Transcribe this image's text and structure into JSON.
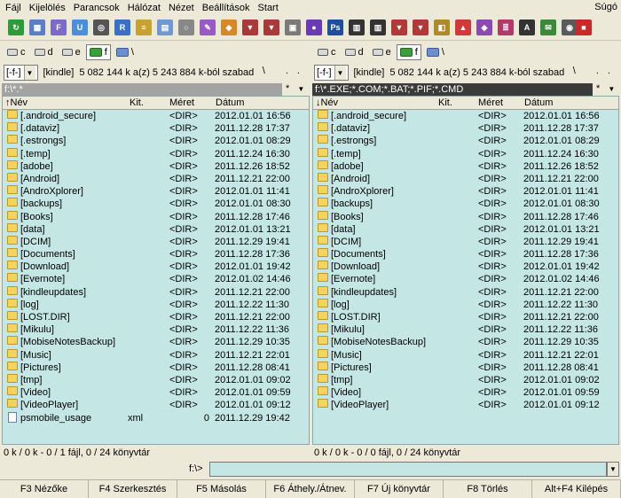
{
  "menu": {
    "items": [
      "Fájl",
      "Kijelölés",
      "Parancsok",
      "Hálózat",
      "Nézet",
      "Beállítások",
      "Start"
    ],
    "help": "Súgó"
  },
  "toolbar_icons": [
    {
      "name": "refresh-icon",
      "color": "#2f9a3a",
      "glyph": "↻"
    },
    {
      "name": "thumbnails-icon",
      "color": "#5a7fc8",
      "glyph": "▦"
    },
    {
      "name": "ftp-icon",
      "color": "#7c6bc4",
      "glyph": "F"
    },
    {
      "name": "url-icon",
      "color": "#4c8fd6",
      "glyph": "U"
    },
    {
      "name": "binoculars-icon",
      "color": "#555555",
      "glyph": "◎"
    },
    {
      "name": "multi-rename-icon",
      "color": "#3a6fc4",
      "glyph": "R"
    },
    {
      "name": "compare-icon",
      "color": "#c8a037",
      "glyph": "≡"
    },
    {
      "name": "calculator-icon",
      "color": "#6f9ad0",
      "glyph": "▤"
    },
    {
      "name": "comment-icon",
      "color": "#888888",
      "glyph": "○"
    },
    {
      "name": "edit-icon",
      "color": "#9a5ac4",
      "glyph": "✎"
    },
    {
      "name": "sync-icon",
      "color": "#d48a2a",
      "glyph": "◆"
    },
    {
      "name": "pack-icon",
      "color": "#a83a3a",
      "glyph": "▼"
    },
    {
      "name": "unpack-icon",
      "color": "#a83a3a",
      "glyph": "▼"
    },
    {
      "name": "app-icon",
      "color": "#7a7a7a",
      "glyph": "▣"
    },
    {
      "name": "media-icon",
      "color": "#6a3ab0",
      "glyph": "●"
    },
    {
      "name": "photoshop-icon",
      "color": "#1f4f9a",
      "glyph": "Ps"
    },
    {
      "name": "film-icon",
      "color": "#333333",
      "glyph": "▥"
    },
    {
      "name": "film2-icon",
      "color": "#333333",
      "glyph": "▥"
    },
    {
      "name": "archive-icon",
      "color": "#b03a3a",
      "glyph": "▼"
    },
    {
      "name": "archive2-icon",
      "color": "#b03a3a",
      "glyph": "▼"
    },
    {
      "name": "image-icon",
      "color": "#b08a2a",
      "glyph": "◧"
    },
    {
      "name": "chart-icon",
      "color": "#d03a3a",
      "glyph": "▲"
    },
    {
      "name": "tag-icon",
      "color": "#8a4ab0",
      "glyph": "◆"
    },
    {
      "name": "books-icon",
      "color": "#b03a6a",
      "glyph": "≣"
    },
    {
      "name": "font-icon",
      "color": "#333333",
      "glyph": "A"
    },
    {
      "name": "mail-icon",
      "color": "#3a8a3a",
      "glyph": "✉"
    },
    {
      "name": "cd-icon",
      "color": "#5a5a5a",
      "glyph": "◉"
    },
    {
      "name": "stop-icon",
      "color": "#c82a2a",
      "glyph": "■"
    }
  ],
  "left": {
    "drives": [
      "c",
      "d",
      "e",
      "f",
      "\\"
    ],
    "active_drive": "f",
    "drive_select": "[-f-]",
    "volume": "[kindle]",
    "free_text": "5 082 144 k a(z) 5 243 884 k-ból szabad",
    "nav_root": "\\",
    "nav_up": "..",
    "path": "f:\\*.*",
    "path_star": "*",
    "path_arrow": "▼",
    "headers": {
      "name": "↑Név",
      "ext": "Kit.",
      "size": "Méret",
      "date": "Dátum"
    },
    "rows": [
      {
        "name": "[.android_secure]",
        "ext": "",
        "size": "<DIR>",
        "date": "2012.01.01 16:56",
        "type": "dir"
      },
      {
        "name": "[.dataviz]",
        "ext": "",
        "size": "<DIR>",
        "date": "2011.12.28 17:37",
        "type": "dir"
      },
      {
        "name": "[.estrongs]",
        "ext": "",
        "size": "<DIR>",
        "date": "2012.01.01 08:29",
        "type": "dir"
      },
      {
        "name": "[.temp]",
        "ext": "",
        "size": "<DIR>",
        "date": "2011.12.24 16:30",
        "type": "dir"
      },
      {
        "name": "[adobe]",
        "ext": "",
        "size": "<DIR>",
        "date": "2011.12.26 18:52",
        "type": "dir"
      },
      {
        "name": "[Android]",
        "ext": "",
        "size": "<DIR>",
        "date": "2011.12.21 22:00",
        "type": "dir"
      },
      {
        "name": "[AndroXplorer]",
        "ext": "",
        "size": "<DIR>",
        "date": "2012.01.01 11:41",
        "type": "dir"
      },
      {
        "name": "[backups]",
        "ext": "",
        "size": "<DIR>",
        "date": "2012.01.01 08:30",
        "type": "dir"
      },
      {
        "name": "[Books]",
        "ext": "",
        "size": "<DIR>",
        "date": "2011.12.28 17:46",
        "type": "dir"
      },
      {
        "name": "[data]",
        "ext": "",
        "size": "<DIR>",
        "date": "2012.01.01 13:21",
        "type": "dir"
      },
      {
        "name": "[DCIM]",
        "ext": "",
        "size": "<DIR>",
        "date": "2011.12.29 19:41",
        "type": "dir"
      },
      {
        "name": "[Documents]",
        "ext": "",
        "size": "<DIR>",
        "date": "2011.12.28 17:36",
        "type": "dir"
      },
      {
        "name": "[Download]",
        "ext": "",
        "size": "<DIR>",
        "date": "2012.01.01 19:42",
        "type": "dir"
      },
      {
        "name": "[Evernote]",
        "ext": "",
        "size": "<DIR>",
        "date": "2012.01.02 14:46",
        "type": "dir"
      },
      {
        "name": "[kindleupdates]",
        "ext": "",
        "size": "<DIR>",
        "date": "2011.12.21 22:00",
        "type": "dir"
      },
      {
        "name": "[log]",
        "ext": "",
        "size": "<DIR>",
        "date": "2011.12.22 11:30",
        "type": "dir"
      },
      {
        "name": "[LOST.DIR]",
        "ext": "",
        "size": "<DIR>",
        "date": "2011.12.21 22:00",
        "type": "dir"
      },
      {
        "name": "[Mikulu]",
        "ext": "",
        "size": "<DIR>",
        "date": "2011.12.22 11:36",
        "type": "dir"
      },
      {
        "name": "[MobiseNotesBackup]",
        "ext": "",
        "size": "<DIR>",
        "date": "2011.12.29 10:35",
        "type": "dir"
      },
      {
        "name": "[Music]",
        "ext": "",
        "size": "<DIR>",
        "date": "2011.12.21 22:01",
        "type": "dir"
      },
      {
        "name": "[Pictures]",
        "ext": "",
        "size": "<DIR>",
        "date": "2011.12.28 08:41",
        "type": "dir"
      },
      {
        "name": "[tmp]",
        "ext": "",
        "size": "<DIR>",
        "date": "2012.01.01 09:02",
        "type": "dir"
      },
      {
        "name": "[Video]",
        "ext": "",
        "size": "<DIR>",
        "date": "2012.01.01 09:59",
        "type": "dir"
      },
      {
        "name": "[VideoPlayer]",
        "ext": "",
        "size": "<DIR>",
        "date": "2012.01.01 09:12",
        "type": "dir"
      },
      {
        "name": "psmobile_usage",
        "ext": "xml",
        "size": "0",
        "date": "2011.12.29 19:42",
        "type": "file"
      }
    ],
    "status": "0 k / 0 k - 0 / 1 fájl, 0 / 24 könyvtár"
  },
  "right": {
    "drives": [
      "c",
      "d",
      "e",
      "f",
      "\\"
    ],
    "active_drive": "f",
    "drive_select": "[-f-]",
    "volume": "[kindle]",
    "free_text": "5 082 144 k a(z) 5 243 884 k-ból szabad",
    "nav_root": "\\",
    "nav_up": "..",
    "path": "f:\\*.EXE;*.COM;*.BAT;*.PIF;*.CMD",
    "path_star": "*",
    "path_arrow": "▼",
    "headers": {
      "name": "↓Név",
      "ext": "Kit.",
      "size": "Méret",
      "date": "Dátum"
    },
    "rows": [
      {
        "name": "[.android_secure]",
        "ext": "",
        "size": "<DIR>",
        "date": "2012.01.01 16:56",
        "type": "dir"
      },
      {
        "name": "[.dataviz]",
        "ext": "",
        "size": "<DIR>",
        "date": "2011.12.28 17:37",
        "type": "dir"
      },
      {
        "name": "[.estrongs]",
        "ext": "",
        "size": "<DIR>",
        "date": "2012.01.01 08:29",
        "type": "dir"
      },
      {
        "name": "[.temp]",
        "ext": "",
        "size": "<DIR>",
        "date": "2011.12.24 16:30",
        "type": "dir"
      },
      {
        "name": "[adobe]",
        "ext": "",
        "size": "<DIR>",
        "date": "2011.12.26 18:52",
        "type": "dir"
      },
      {
        "name": "[Android]",
        "ext": "",
        "size": "<DIR>",
        "date": "2011.12.21 22:00",
        "type": "dir"
      },
      {
        "name": "[AndroXplorer]",
        "ext": "",
        "size": "<DIR>",
        "date": "2012.01.01 11:41",
        "type": "dir"
      },
      {
        "name": "[backups]",
        "ext": "",
        "size": "<DIR>",
        "date": "2012.01.01 08:30",
        "type": "dir"
      },
      {
        "name": "[Books]",
        "ext": "",
        "size": "<DIR>",
        "date": "2011.12.28 17:46",
        "type": "dir"
      },
      {
        "name": "[data]",
        "ext": "",
        "size": "<DIR>",
        "date": "2012.01.01 13:21",
        "type": "dir"
      },
      {
        "name": "[DCIM]",
        "ext": "",
        "size": "<DIR>",
        "date": "2011.12.29 19:41",
        "type": "dir"
      },
      {
        "name": "[Documents]",
        "ext": "",
        "size": "<DIR>",
        "date": "2011.12.28 17:36",
        "type": "dir"
      },
      {
        "name": "[Download]",
        "ext": "",
        "size": "<DIR>",
        "date": "2012.01.01 19:42",
        "type": "dir"
      },
      {
        "name": "[Evernote]",
        "ext": "",
        "size": "<DIR>",
        "date": "2012.01.02 14:46",
        "type": "dir"
      },
      {
        "name": "[kindleupdates]",
        "ext": "",
        "size": "<DIR>",
        "date": "2011.12.21 22:00",
        "type": "dir"
      },
      {
        "name": "[log]",
        "ext": "",
        "size": "<DIR>",
        "date": "2011.12.22 11:30",
        "type": "dir"
      },
      {
        "name": "[LOST.DIR]",
        "ext": "",
        "size": "<DIR>",
        "date": "2011.12.21 22:00",
        "type": "dir"
      },
      {
        "name": "[Mikulu]",
        "ext": "",
        "size": "<DIR>",
        "date": "2011.12.22 11:36",
        "type": "dir"
      },
      {
        "name": "[MobiseNotesBackup]",
        "ext": "",
        "size": "<DIR>",
        "date": "2011.12.29 10:35",
        "type": "dir"
      },
      {
        "name": "[Music]",
        "ext": "",
        "size": "<DIR>",
        "date": "2011.12.21 22:01",
        "type": "dir"
      },
      {
        "name": "[Pictures]",
        "ext": "",
        "size": "<DIR>",
        "date": "2011.12.28 08:41",
        "type": "dir"
      },
      {
        "name": "[tmp]",
        "ext": "",
        "size": "<DIR>",
        "date": "2012.01.01 09:02",
        "type": "dir"
      },
      {
        "name": "[Video]",
        "ext": "",
        "size": "<DIR>",
        "date": "2012.01.01 09:59",
        "type": "dir"
      },
      {
        "name": "[VideoPlayer]",
        "ext": "",
        "size": "<DIR>",
        "date": "2012.01.01 09:12",
        "type": "dir"
      }
    ],
    "status": "0 k / 0 k - 0 / 0 fájl, 0 / 24 könyvtár"
  },
  "cmdline": {
    "label": "f:\\>",
    "value": "",
    "arrow": "▼"
  },
  "fkeys": [
    "F3 Nézőke",
    "F4 Szerkesztés",
    "F5 Másolás",
    "F6 Áthely./Átnev.",
    "F7 Új könyvtár",
    "F8 Törlés",
    "Alt+F4 Kilépés"
  ],
  "colors": {
    "panel_bg": "#c4e6e4",
    "folder": "#f5d35e",
    "path_active": "#3a3a3a",
    "path_inactive": "#a3a3a3"
  }
}
